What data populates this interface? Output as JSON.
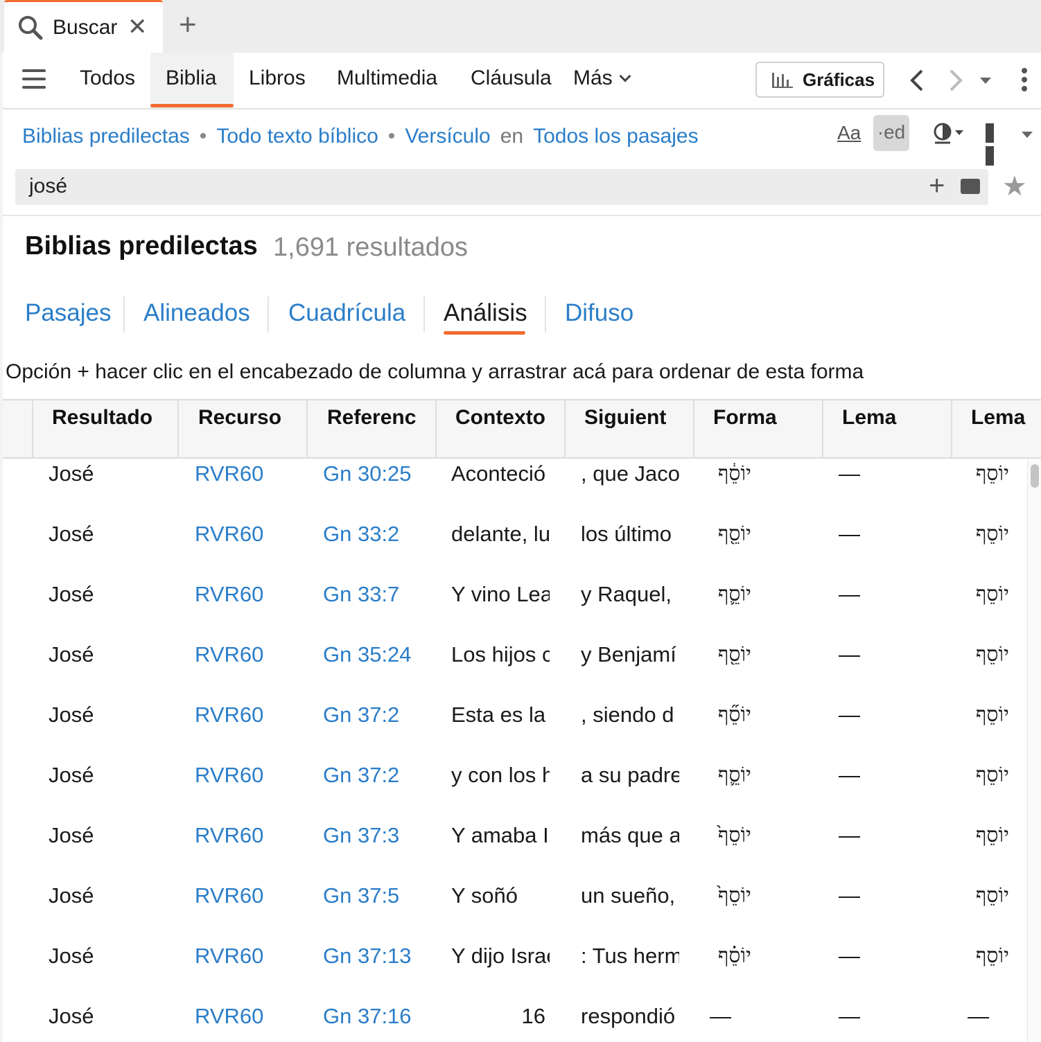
{
  "tab": {
    "label": "Buscar",
    "close": "✕",
    "new": "+"
  },
  "nav": {
    "items": [
      "Todos",
      "Biblia",
      "Libros",
      "Multimedia",
      "Cláusula",
      "Más"
    ],
    "graficas": "Gráficas"
  },
  "scope": {
    "bibles": "Biblias predilectas",
    "text": "Todo texto bíblico",
    "unit": "Versículo",
    "en": "en",
    "range": "Todos los pasajes",
    "aa": "Aa",
    "ed": "·ed"
  },
  "search": {
    "value": "josé",
    "plus": "+"
  },
  "results": {
    "title": "Biblias predilectas",
    "count": "1,691 resultados"
  },
  "views": [
    "Pasajes",
    "Alineados",
    "Cuadrícula",
    "Análisis",
    "Difuso"
  ],
  "hint": "Opción + hacer clic en el encabezado de columna y arrastrar acá para ordenar de esta forma",
  "table": {
    "headers": [
      "Resultado",
      "Recurso",
      "Referenc",
      "Contexto",
      "Siguient",
      "Forma",
      "Lema",
      "Lema"
    ],
    "rows": [
      [
        "José",
        "RVR60",
        "Gn 30:25",
        "Aconteció",
        ", que Jaco",
        "יוֹסֵ֔ף",
        "—",
        "יוֹסֵף"
      ],
      [
        "José",
        "RVR60",
        "Gn 33:2",
        "delante, lu",
        "los último",
        "יוֹסֵ֖ף",
        "—",
        "יוֹסֵף"
      ],
      [
        "José",
        "RVR60",
        "Gn 33:7",
        "Y vino Lea",
        "y Raquel,",
        "יוֹסֵ֛ף",
        "—",
        "יוֹסֵף"
      ],
      [
        "José",
        "RVR60",
        "Gn 35:24",
        "Los hijos c",
        "y Benjamí",
        "יוֹסֵ֖ף",
        "—",
        "יוֹסֵף"
      ],
      [
        "José",
        "RVR60",
        "Gn 37:2",
        "Esta es la l",
        ", siendo d",
        "יוֹסֵ֞ף",
        "—",
        "יוֹסֵף"
      ],
      [
        "José",
        "RVR60",
        "Gn 37:2",
        "y con los h",
        "a su padre",
        "יוֹסֵ֛ף",
        "—",
        "יוֹסֵף"
      ],
      [
        "José",
        "RVR60",
        "Gn 37:3",
        "Y amaba Is",
        "más que a",
        "יוֹסֵף֙",
        "—",
        "יוֹסֵף"
      ],
      [
        "José",
        "RVR60",
        "Gn 37:5",
        "Y soñó",
        "un sueño,",
        "יוֹסֵף֙",
        "—",
        "יוֹסֵף"
      ],
      [
        "José",
        "RVR60",
        "Gn 37:13",
        "Y dijo Israe",
        ": Tus herm",
        "יוֹסֵ֗ף",
        "—",
        "יוֹסֵף"
      ],
      [
        "José",
        "RVR60",
        "Gn 37:16",
        "16",
        "respondió",
        "—",
        "—",
        "—"
      ]
    ]
  },
  "colors": {
    "accent": "#f26b2e",
    "link": "#2a7dc9"
  }
}
